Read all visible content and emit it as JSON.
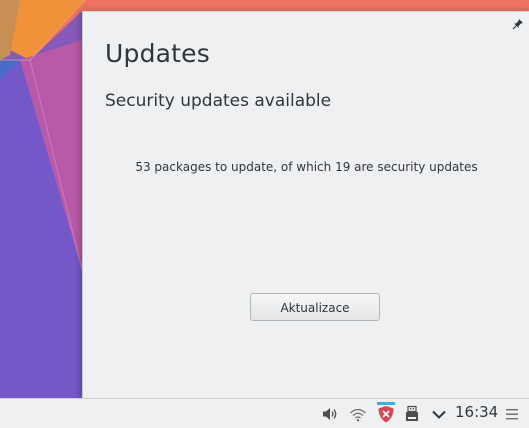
{
  "popup": {
    "title": "Updates",
    "subtitle": "Security updates available",
    "description": "53 packages to update, of which 19 are security updates",
    "update_button_label": "Aktualizace",
    "pin_icon": "pin-icon"
  },
  "panel": {
    "clock": "16:34",
    "tray_icons": [
      "volume-icon",
      "wifi-icon",
      "security-updates-shield-icon",
      "usb-device-icon",
      "expand-tray-chevron-icon",
      "panel-menu-icon"
    ]
  },
  "colors": {
    "window_bg": "#eff0f1",
    "text": "#31363b",
    "shield_red": "#da4453",
    "wallpaper_orange": "#e8873a",
    "wallpaper_purple": "#7a55c8"
  }
}
